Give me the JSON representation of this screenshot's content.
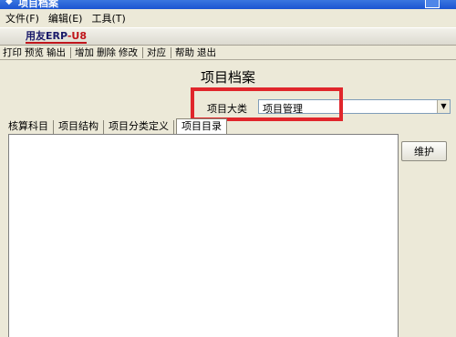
{
  "window": {
    "title": "项目档案"
  },
  "menu": [
    {
      "label": "文件(F)"
    },
    {
      "label": "编辑(E)"
    },
    {
      "label": "工具(T)"
    }
  ],
  "brand": {
    "text_main": "用友ERP",
    "text_suffix": "-U8"
  },
  "toolbar": {
    "group1": [
      "打印",
      "预览",
      "输出"
    ],
    "group2": [
      "增加",
      "删除",
      "修改"
    ],
    "group3": [
      "对应"
    ],
    "group4": [
      "帮助",
      "退出"
    ]
  },
  "page": {
    "title": "项目档案"
  },
  "category": {
    "label": "项目大类",
    "value": "项目管理"
  },
  "tabs": [
    {
      "label": "核算科目"
    },
    {
      "label": "项目结构"
    },
    {
      "label": "项目分类定义"
    },
    {
      "label": "项目目录"
    }
  ],
  "buttons": {
    "maintain": "维护"
  },
  "colors": {
    "highlight": "#e0262b",
    "titlebar": "#1b54d1"
  }
}
